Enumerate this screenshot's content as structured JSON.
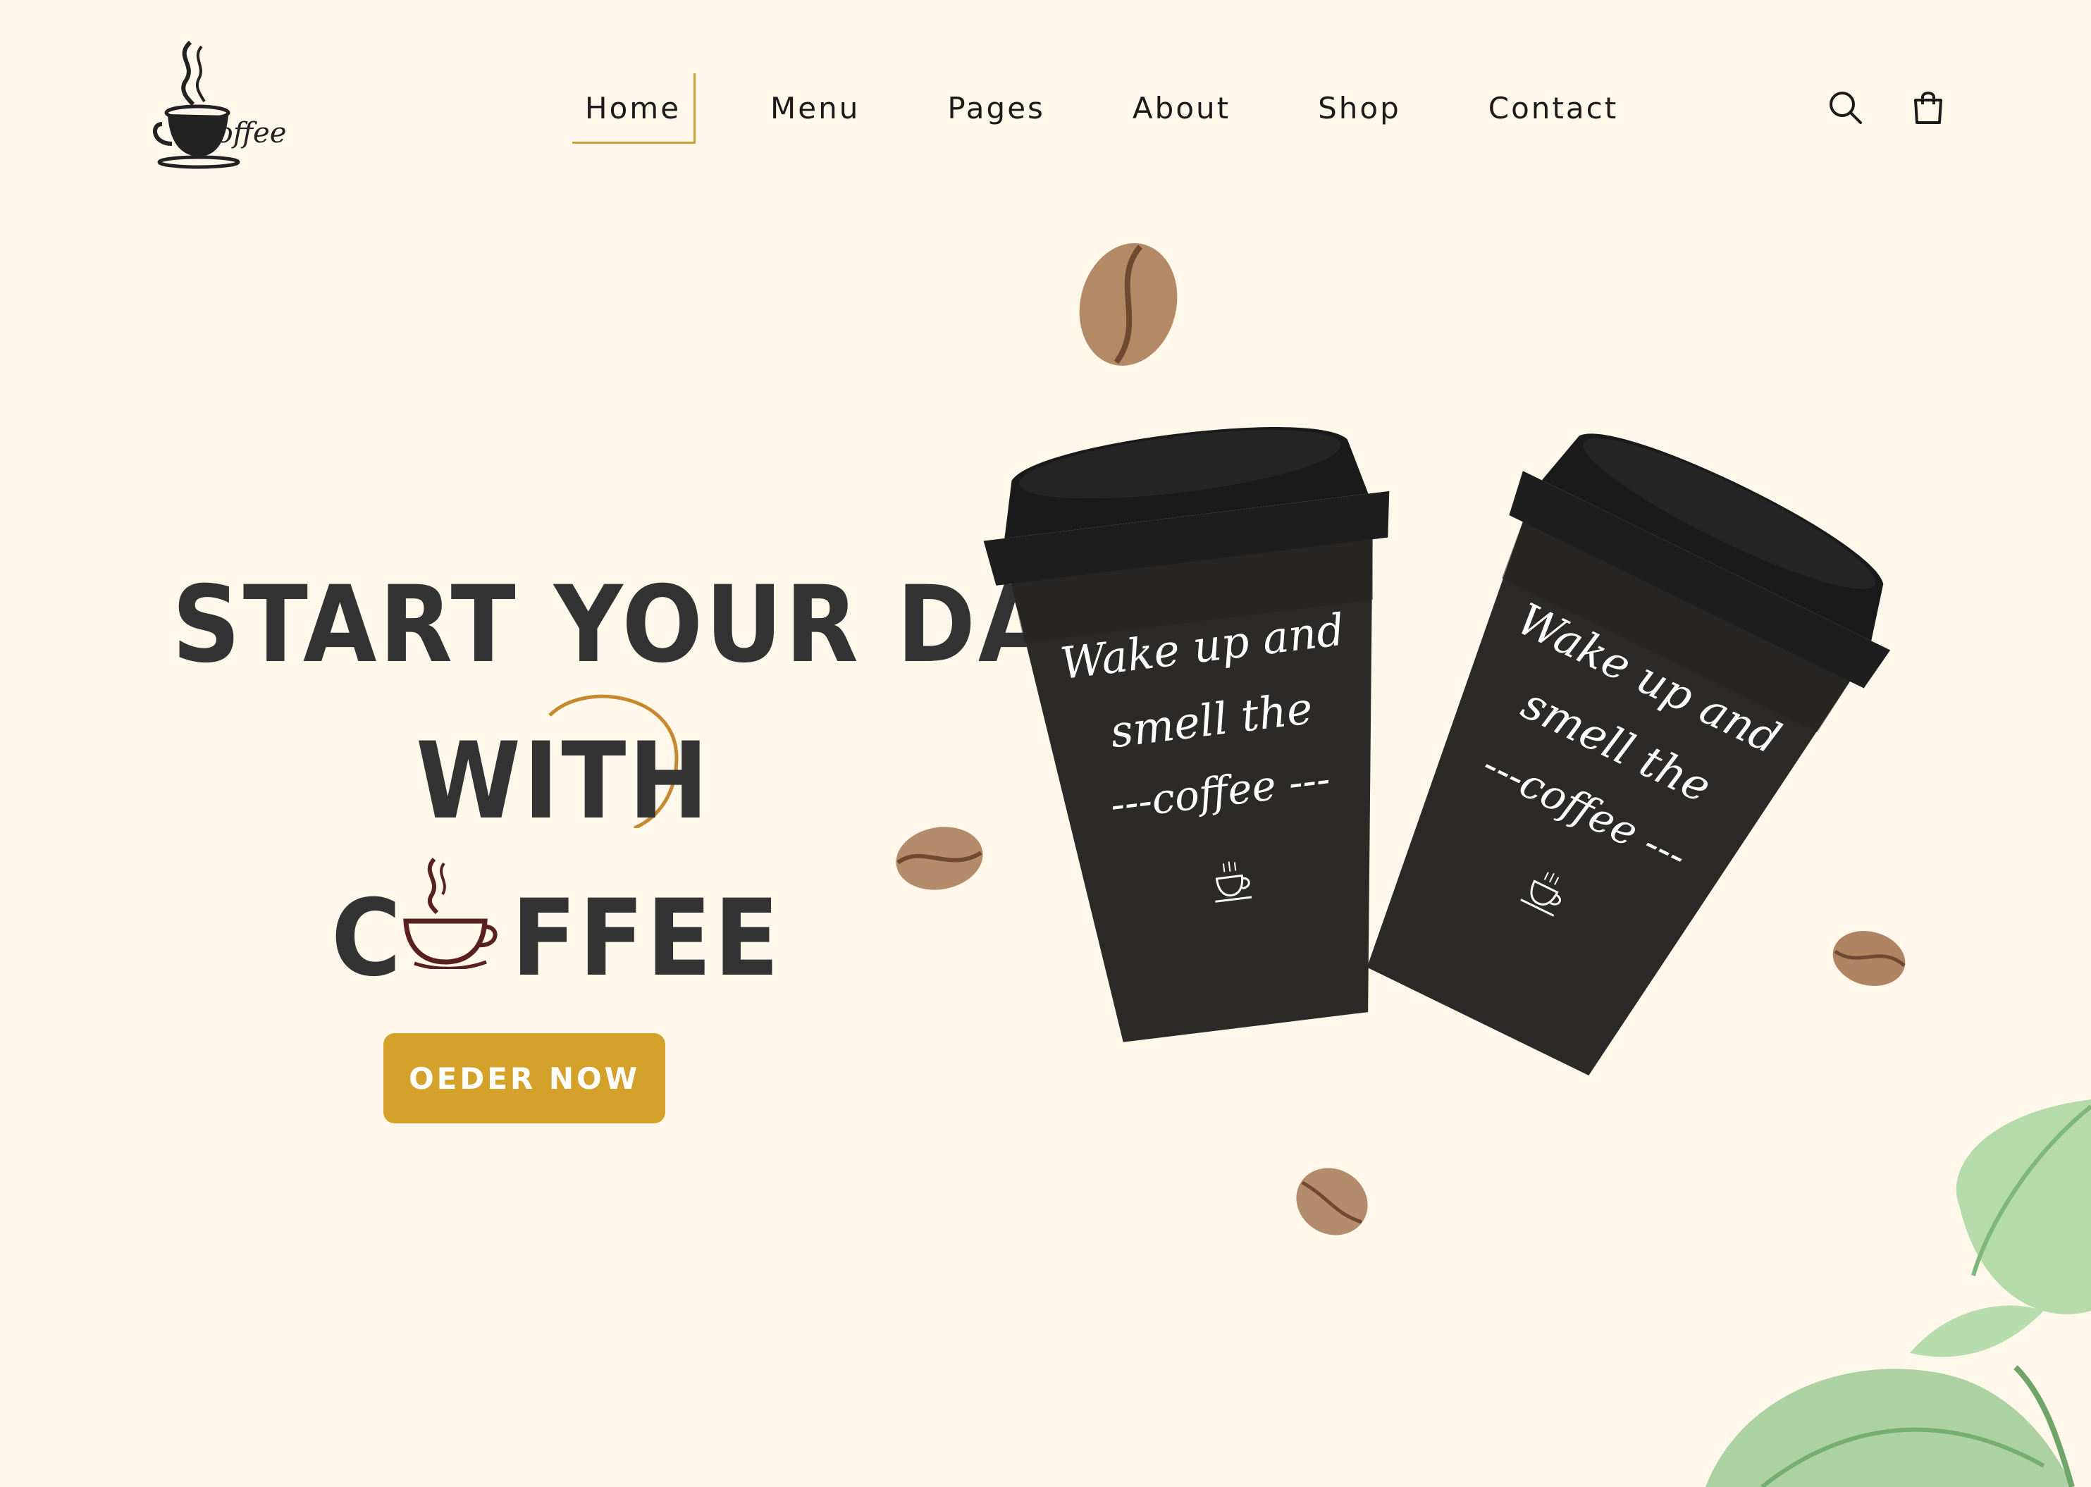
{
  "brand": {
    "logo_text": "Coffee"
  },
  "nav": {
    "items": [
      {
        "label": "Home",
        "active": true
      },
      {
        "label": "Menu"
      },
      {
        "label": "Pages"
      },
      {
        "label": "About"
      },
      {
        "label": "Shop"
      },
      {
        "label": "Contact"
      }
    ]
  },
  "header_icons": [
    "search-icon",
    "shopping-bag-icon"
  ],
  "hero": {
    "line1": "START YOUR DAY",
    "line2": "WITH",
    "line3_prefix": "C",
    "line3_suffix": "FFEE",
    "cta_label": "OEDER NOW"
  },
  "cups": {
    "print_line1": "Wake up and",
    "print_line2": "smell the",
    "print_line3": "---coffee ---"
  },
  "colors": {
    "background": "#FFF7EA",
    "accent": "#D4A12B",
    "heading": "#333333",
    "cup": "#2B2A28",
    "lid": "#1E1E1F"
  }
}
